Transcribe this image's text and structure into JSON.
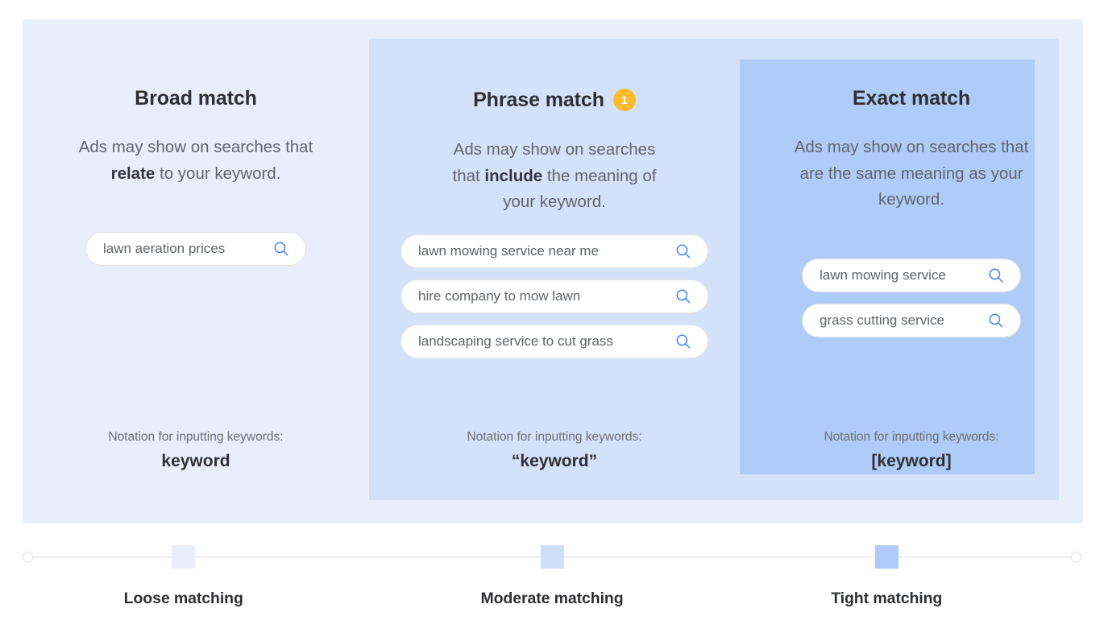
{
  "palette": {
    "panel_outer": "#E8EEFC",
    "panel_mid": "#D4E2F9",
    "panel_inner": "#AFCBF7",
    "badge": "#FABC2E",
    "search_icon": "#4285F4",
    "heading": "#2F3033",
    "body_text": "#61656B",
    "pill_bg": "#FFFFFF",
    "scale_line": "#ECEEF0"
  },
  "columns": [
    {
      "title": "Broad match",
      "badge": null,
      "description_parts": [
        "Ads may show on searches that ",
        "relate",
        " to your keyword."
      ],
      "searches": [
        {
          "text": "lawn aeration prices",
          "icon": "search-icon"
        }
      ],
      "notation_label": "Notation for inputting keywords:",
      "notation_value": "keyword"
    },
    {
      "title": "Phrase match",
      "badge": "1",
      "description_parts": [
        "Ads may show on searches that ",
        "include",
        " the meaning of your keyword."
      ],
      "searches": [
        {
          "text": "lawn mowing service near me",
          "icon": "search-icon"
        },
        {
          "text": "hire company to mow lawn",
          "icon": "search-icon"
        },
        {
          "text": "landscaping service to cut grass",
          "icon": "search-icon"
        }
      ],
      "notation_label": "Notation for inputting keywords:",
      "notation_value": "“keyword”"
    },
    {
      "title": "Exact match",
      "badge": null,
      "description_parts": [
        "Ads may show on searches that are the same meaning as your keyword.",
        "",
        ""
      ],
      "searches": [
        {
          "text": "lawn mowing service",
          "icon": "search-icon"
        },
        {
          "text": "grass cutting service",
          "icon": "search-icon"
        }
      ],
      "notation_label": "Notation for inputting keywords:",
      "notation_value": "[keyword]"
    }
  ],
  "scale": {
    "stops": [
      {
        "label": "Loose matching",
        "position_pct": 15.2,
        "marker_color": "#E8EEFC"
      },
      {
        "label": "Moderate matching",
        "position_pct": 50.0,
        "marker_color": "#D4E2F9"
      },
      {
        "label": "Tight matching",
        "position_pct": 81.6,
        "marker_color": "#AFCBF7"
      }
    ],
    "left_cap": "circle-endpoint",
    "right_cap": "circle-endpoint"
  }
}
